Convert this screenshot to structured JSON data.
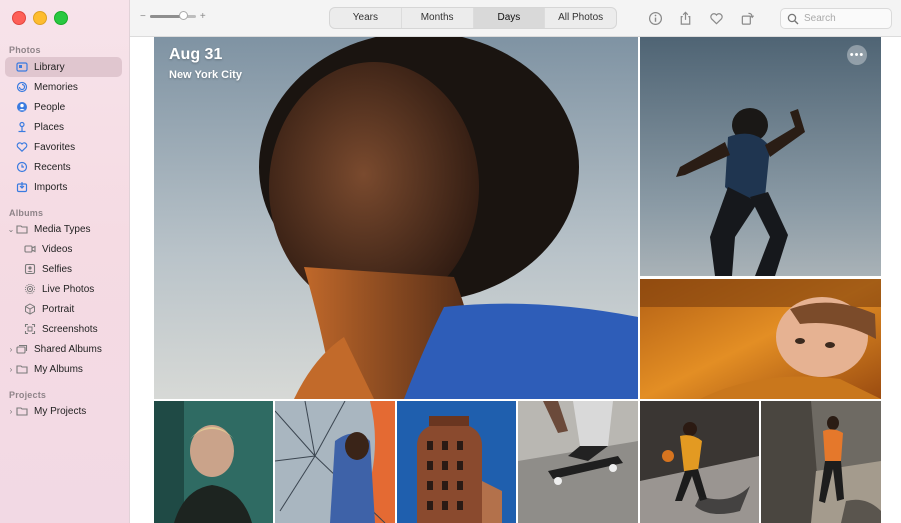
{
  "sidebar": {
    "photos_label": "Photos",
    "library": "Library",
    "memories": "Memories",
    "people": "People",
    "places": "Places",
    "favorites": "Favorites",
    "recents": "Recents",
    "imports": "Imports",
    "albums_label": "Albums",
    "media_types": "Media Types",
    "videos": "Videos",
    "selfies": "Selfies",
    "live_photos": "Live Photos",
    "portrait": "Portrait",
    "screenshots": "Screenshots",
    "shared_albums": "Shared Albums",
    "my_albums": "My Albums",
    "projects_label": "Projects",
    "my_projects": "My Projects"
  },
  "toolbar": {
    "zoom_minus": "−",
    "zoom_plus": "+",
    "zoom_level": 0.78,
    "tabs": [
      "Years",
      "Months",
      "Days",
      "All Photos"
    ],
    "active_tab": "Days",
    "search_placeholder": "Search"
  },
  "content": {
    "date_title": "Aug 31",
    "location": "New York City",
    "more_label": "•••"
  },
  "colors": {
    "accent": "#3a7be0",
    "sidebar_bg": "#f5dbe3",
    "selected_bg": "#e0c6cf"
  }
}
